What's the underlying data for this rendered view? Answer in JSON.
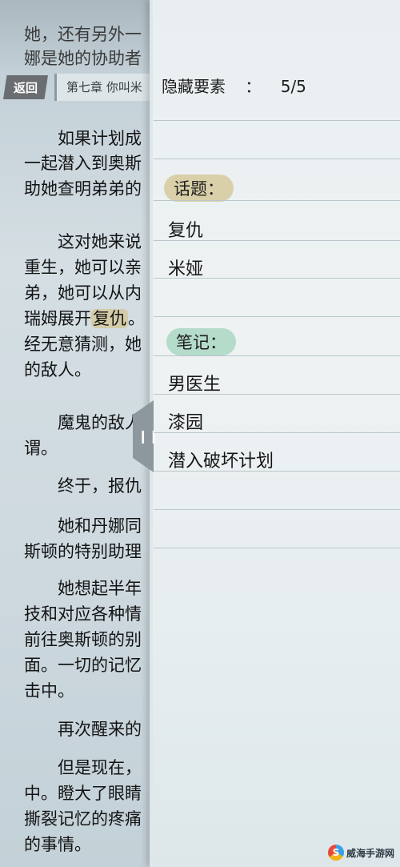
{
  "reader": {
    "lines_top": [
      "她，还有另外一",
      "娜是她的协助者"
    ],
    "back_label": "返回",
    "chapter_title": "第七章 你叫米",
    "para1": [
      "如果计划成",
      "一起潜入到奥斯",
      "助她查明弟弟的"
    ],
    "para2_lines": [
      "这对她来说",
      "重生，她可以亲",
      "弟，她可以从内"
    ],
    "para2_hl_prefix": "瑞姆展开",
    "para2_hl_word": "复仇",
    "para2_hl_suffix": "。",
    "para2_more": [
      "经无意猜测，她",
      "的敌人。"
    ],
    "para3": [
      "魔鬼的敌人",
      "谓。"
    ],
    "para4": [
      "终于，报仇"
    ],
    "para5": [
      "她和丹娜同",
      "斯顿的特别助理"
    ],
    "para6": [
      "她想起半年",
      "技和对应各种情",
      "前往奥斯顿的别",
      "面。一切的记忆",
      "击中。"
    ],
    "para7": [
      "再次醒来的"
    ],
    "para8": [
      "但是现在，",
      "中。瞪大了眼睛",
      "撕裂记忆的疼痛",
      "的事情。"
    ]
  },
  "panel": {
    "title_label": "隐藏要素",
    "title_sep": "：",
    "title_count": "5/5",
    "topics_label": "话题：",
    "topics": [
      "复仇",
      "米娅"
    ],
    "notes_label": "笔记：",
    "notes": [
      "男医生",
      "漆园",
      "潜入破坏计划"
    ]
  },
  "handle": {
    "icon": "double-bar-icon"
  },
  "watermark": {
    "text": "威海手游网",
    "logo_glyph": "S"
  },
  "colors": {
    "topics_highlight": "#d2c28c",
    "notes_highlight": "#96ceb4",
    "back_button": "#6a6e72"
  }
}
